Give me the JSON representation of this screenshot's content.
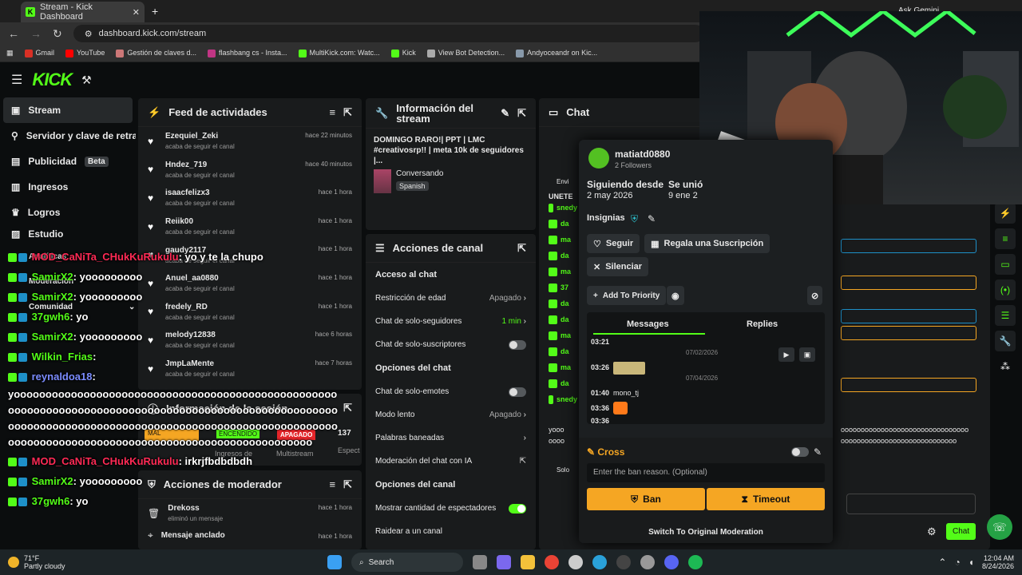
{
  "browser": {
    "tab_title": "Stream - Kick Dashboard",
    "url": "dashboard.kick.com/stream",
    "ask": "Ask Gemini",
    "bookmarks": [
      "Gmail",
      "YouTube",
      "Gestión de claves d...",
      "flashbang cs - Insta...",
      "MultiKick.com: Watc...",
      "Kick",
      "View Bot Detection...",
      "Andyoceandr on Kic..."
    ]
  },
  "sidebar": {
    "items": [
      "Stream",
      "Servidor y clave de retransmisión",
      "Publicidad",
      "Ingresos",
      "Logros",
      "Estudio",
      "Analíticas",
      "Moderación",
      "Comunidad"
    ],
    "beta": "Beta"
  },
  "feed": {
    "title": "Feed de actividades",
    "sub": "acaba de seguir el canal",
    "rows": [
      [
        "Ezequiel_Zeki",
        "hace 22 minutos"
      ],
      [
        "Hndez_719",
        "hace 40 minutos"
      ],
      [
        "isaacfelizx3",
        "hace 1 hora"
      ],
      [
        "Reiik00",
        "hace 1 hora"
      ],
      [
        "gaudy2117",
        "hace 1 hora"
      ],
      [
        "Anuel_aa0880",
        "hace 1 hora"
      ],
      [
        "fredely_RD",
        "hace 1 hora"
      ],
      [
        "melody12838",
        "hace 6 horas"
      ],
      [
        "JmpLaMente",
        "hace 7 horas"
      ]
    ]
  },
  "session": {
    "title": "Información de la sesión",
    "mal": "MAL",
    "encendido": "ENCENDIDO",
    "apagado": "APAGADO",
    "num": "137",
    "ingresos": "Ingresos de",
    "multistream": "Multistream",
    "espect": "Espect"
  },
  "modactions": {
    "title": "Acciones de moderador",
    "rows": [
      [
        "Drekoss",
        "eliminó un mensaje",
        "hace 1 hora"
      ],
      [
        "Mensaje anclado",
        "",
        "hace 1 hora"
      ]
    ]
  },
  "info": {
    "title": "Información del stream",
    "stream_title": "DOMINGO RARO!| PPT | LMC #creativosrp!! | meta 10k de seguidores |...",
    "category": "Conversando",
    "lang": "Spanish"
  },
  "actions": {
    "title": "Acciones de canal",
    "s1": "Acceso al chat",
    "edad": "Restricción de edad",
    "edad_v": "Apagado",
    "seg": "Chat de solo-seguidores",
    "seg_v": "1 min",
    "subs": "Chat de solo-suscriptores",
    "s2": "Opciones del chat",
    "emotes": "Chat de solo-emotes",
    "lento": "Modo lento",
    "lento_v": "Apagado",
    "banned": "Palabras baneadas",
    "ia": "Moderación del chat con IA",
    "s3": "Opciones del canal",
    "mostrar": "Mostrar cantidad de espectadores",
    "raid": "Raidear a un canal"
  },
  "chat": {
    "title": "Chat",
    "env": "Envi",
    "unete": "UNETE",
    "sol": "Solo",
    "send": "Chat",
    "mini": [
      "snedy",
      "da",
      "ma",
      "da",
      "ma",
      "37",
      "da",
      "da",
      "ma",
      "da",
      "ma",
      "da",
      "snedy"
    ],
    "right_text": [
      "oooooooooooooooooooooooooooooooo",
      "ooooooooooooooooooooooooooooo"
    ],
    "left_y": [
      "yooo",
      "oooo",
      "oooo"
    ]
  },
  "user": {
    "name": "matiatd0880",
    "followers": "2 Followers",
    "since_label": "Siguiendo desde",
    "since": "2 may 2026",
    "joined_label": "Se unió",
    "joined": "9 ene 2",
    "insignias": "Insignias",
    "seguir": "Seguir",
    "regala": "Regala una Suscripción",
    "silenciar": "Silenciar",
    "priority": "Add To Priority",
    "tab_msgs": "Messages",
    "tab_replies": "Replies",
    "msgs": [
      {
        "t": "03:21",
        "text": ""
      },
      {
        "t": "03:26",
        "text": ""
      },
      {
        "t": "01:40",
        "text": "mono_tj"
      },
      {
        "t": "03:36",
        "text": ""
      },
      {
        "t": "03:36",
        "text": ""
      }
    ],
    "dates": [
      "07/02/2026",
      "07/04/2026"
    ],
    "cross": "Cross",
    "reason_ph": "Enter the ban reason. (Optional)",
    "ban": "Ban",
    "timeout": "Timeout",
    "switch": "Switch To Original Moderation"
  },
  "overlay": [
    {
      "u": "MOD_CaNiTa_CHukKuRukulu",
      "m": ": yo y te la chupo",
      "c": "#ff2a55"
    },
    {
      "u": "SamirX2",
      "m": ": yooooooooo",
      "c": "#53fc18"
    },
    {
      "u": "SamirX2",
      "m": ": yooooooooo",
      "c": "#53fc18"
    },
    {
      "u": "37gwh6",
      "m": ": yo",
      "c": "#53fc18"
    },
    {
      "u": "SamirX2",
      "m": ": yooooooooo",
      "c": "#53fc18"
    },
    {
      "u": "Wilkin_Frias",
      "m": ":",
      "c": "#53fc18"
    },
    {
      "u": "reynaldoa18",
      "m": ":",
      "c": "#7b8cff"
    }
  ],
  "overlay_long": [
    "yooooooooooooooooooooooooooooooooooooooooooooooooooo",
    "oooooooooooooooooooooooooooooooooooooooooooooooooooo",
    "oooooooooooooooooooooooooooooooooooooooooooooooooooo",
    "oooooooooooooooooooooooooooooooooooooooooooooooo"
  ],
  "overlay2": [
    {
      "u": "MOD_CaNiTa_CHukKuRukulu",
      "m": ": irkrjfbdbdbdh",
      "c": "#ff2a55"
    },
    {
      "u": "SamirX2",
      "m": ": yooooooooo",
      "c": "#53fc18"
    },
    {
      "u": "37gwh6",
      "m": ": yo",
      "c": "#53fc18"
    }
  ],
  "taskbar": {
    "temp": "71°F",
    "weather": "Partly cloudy",
    "search": "Search",
    "time": "12:04 AM",
    "date": "8/24/2026"
  }
}
